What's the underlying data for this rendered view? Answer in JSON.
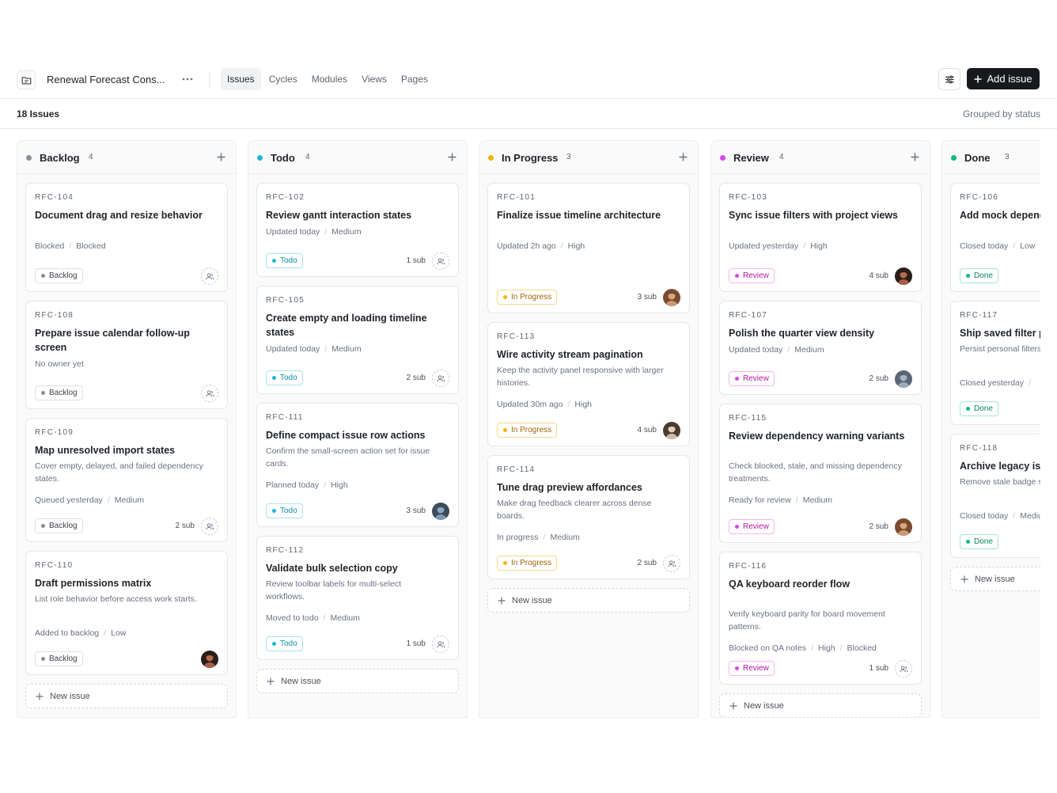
{
  "header": {
    "project_name": "Renewal Forecast Cons...",
    "tabs": [
      {
        "label": "Issues",
        "active": true
      },
      {
        "label": "Cycles",
        "active": false
      },
      {
        "label": "Modules",
        "active": false
      },
      {
        "label": "Views",
        "active": false
      },
      {
        "label": "Pages",
        "active": false
      }
    ],
    "add_issue_label": "Add issue"
  },
  "subbar": {
    "issue_count": "18 Issues",
    "grouped_label": "Grouped by status"
  },
  "new_issue_label": "New issue",
  "columns": [
    {
      "title": "Backlog",
      "count": "4",
      "color": "#8a8f98",
      "cards": [
        {
          "id": "RFC-104",
          "title": "Document drag and resize behavior",
          "desc": "",
          "meta": [
            "Blocked",
            "Blocked"
          ],
          "status": "Backlog",
          "sub": "",
          "assignee": "unassigned"
        },
        {
          "id": "RFC-108",
          "title": "Prepare issue calendar follow-up screen",
          "desc": "",
          "meta": [
            "No owner yet"
          ],
          "status": "Backlog",
          "sub": "",
          "assignee": "unassigned"
        },
        {
          "id": "RFC-109",
          "title": "Map unresolved import states",
          "desc": "Cover empty, delayed, and failed dependency states.",
          "meta": [
            "Queued yesterday",
            "Medium"
          ],
          "status": "Backlog",
          "sub": "2 sub",
          "assignee": "unassigned"
        },
        {
          "id": "RFC-110",
          "title": "Draft permissions matrix",
          "desc": "List role behavior before access work starts.",
          "meta": [
            "Added to backlog",
            "Low"
          ],
          "status": "Backlog",
          "sub": "",
          "assignee": "avatar-dark"
        }
      ]
    },
    {
      "title": "Todo",
      "count": "4",
      "color": "#1fb6d4",
      "cards": [
        {
          "id": "RFC-102",
          "title": "Review gantt interaction states",
          "desc": "",
          "meta": [
            "Updated today",
            "Medium"
          ],
          "status": "Todo",
          "sub": "1 sub",
          "assignee": "unassigned"
        },
        {
          "id": "RFC-105",
          "title": "Create empty and loading timeline states",
          "desc": "",
          "meta": [
            "Updated today",
            "Medium"
          ],
          "status": "Todo",
          "sub": "2 sub",
          "assignee": "unassigned"
        },
        {
          "id": "RFC-111",
          "title": "Define compact issue row actions",
          "desc": "Confirm the small-screen action set for issue cards.",
          "meta": [
            "Planned today",
            "High"
          ],
          "status": "Todo",
          "sub": "3 sub",
          "assignee": "avatar-blue"
        },
        {
          "id": "RFC-112",
          "title": "Validate bulk selection copy",
          "desc": "Review toolbar labels for multi-select workflows.",
          "meta": [
            "Moved to todo",
            "Medium"
          ],
          "status": "Todo",
          "sub": "1 sub",
          "assignee": "unassigned"
        }
      ]
    },
    {
      "title": "In Progress",
      "count": "3",
      "color": "#f5b400",
      "cards": [
        {
          "id": "RFC-101",
          "title": "Finalize issue timeline architecture",
          "desc": "",
          "meta": [
            "Updated 2h ago",
            "High"
          ],
          "status": "In Progress",
          "sub": "3 sub",
          "assignee": "avatar-brown"
        },
        {
          "id": "RFC-113",
          "title": "Wire activity stream pagination",
          "desc": "Keep the activity panel responsive with larger histories.",
          "meta": [
            "Updated 30m ago",
            "High"
          ],
          "status": "In Progress",
          "sub": "4 sub",
          "assignee": "avatar-light"
        },
        {
          "id": "RFC-114",
          "title": "Tune drag preview affordances",
          "desc": "Make drag feedback clearer across dense boards.",
          "meta": [
            "In progress",
            "Medium"
          ],
          "status": "In Progress",
          "sub": "2 sub",
          "assignee": "unassigned"
        }
      ]
    },
    {
      "title": "Review",
      "count": "4",
      "color": "#d946ef",
      "cards": [
        {
          "id": "RFC-103",
          "title": "Sync issue filters with project views",
          "desc": "",
          "meta": [
            "Updated yesterday",
            "High"
          ],
          "status": "Review",
          "sub": "4 sub",
          "assignee": "avatar-dark"
        },
        {
          "id": "RFC-107",
          "title": "Polish the quarter view density",
          "desc": "",
          "meta": [
            "Updated today",
            "Medium"
          ],
          "status": "Review",
          "sub": "2 sub",
          "assignee": "avatar-slate"
        },
        {
          "id": "RFC-115",
          "title": "Review dependency warning variants",
          "desc": "Check blocked, stale, and missing dependency treatments.",
          "meta": [
            "Ready for review",
            "Medium"
          ],
          "status": "Review",
          "sub": "2 sub",
          "assignee": "avatar-brown"
        },
        {
          "id": "RFC-116",
          "title": "QA keyboard reorder flow",
          "desc": "Verify keyboard parity for board movement patterns.",
          "meta": [
            "Blocked on QA notes",
            "High",
            "Blocked"
          ],
          "status": "Review",
          "sub": "1 sub",
          "assignee": "unassigned"
        }
      ]
    },
    {
      "title": "Done",
      "count": "3",
      "color": "#10b981",
      "cards": [
        {
          "id": "RFC-106",
          "title": "Add mock dependency handoff notes",
          "desc": "",
          "meta": [
            "Closed today",
            "Low"
          ],
          "status": "Done",
          "sub": "",
          "assignee": ""
        },
        {
          "id": "RFC-117",
          "title": "Ship saved filter presets",
          "desc": "Persist personal filters across triage sessions.",
          "meta": [
            "Closed yesterday",
            ""
          ],
          "status": "Done",
          "sub": "",
          "assignee": ""
        },
        {
          "id": "RFC-118",
          "title": "Archive legacy issue surfaces",
          "desc": "Remove stale badge surfaces.",
          "meta": [
            "Closed today",
            "Medium"
          ],
          "status": "Done",
          "sub": "",
          "assignee": ""
        }
      ]
    }
  ],
  "status_styles": {
    "Backlog": {
      "fg": "#3f444b",
      "bg": "#ffffff",
      "border": "#dfe1e5",
      "dot": "#8a8f98"
    },
    "Todo": {
      "fg": "#0e8fa8",
      "bg": "#ffffff",
      "border": "#a9e3ee",
      "dot": "#1fb6d4"
    },
    "In Progress": {
      "fg": "#a16207",
      "bg": "#ffffff",
      "border": "#f5d88a",
      "dot": "#f5b400"
    },
    "Review": {
      "fg": "#b5179e",
      "bg": "#ffffff",
      "border": "#f3b7ee",
      "dot": "#d946ef"
    },
    "Done": {
      "fg": "#06875e",
      "bg": "#ffffff",
      "border": "#a7e6cf",
      "dot": "#10b981"
    }
  }
}
